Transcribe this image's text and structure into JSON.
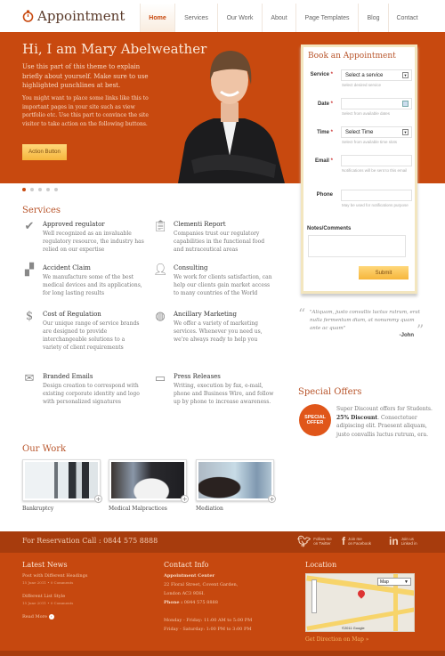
{
  "header": {
    "logo_text": "Appointment",
    "nav": [
      "Home",
      "Services",
      "Our Work",
      "About",
      "Page Templates",
      "Blog",
      "Contact"
    ],
    "active": "Home"
  },
  "hero": {
    "title": "Hi, I am Mary Abelweather",
    "p1": "Use this part of this theme to explain briefly about yourself. Make sure to use highlighted punchlines at best.",
    "p2": "You might want to place some links like this to important pages in your site such as view portfolio etc. Use this part to convince the site visitor to take action on the following buttons.",
    "button": "Action Button",
    "slides": 5,
    "active_slide": 1
  },
  "form": {
    "title": "Book an Appointment",
    "service_label": "Service",
    "service_value": "Select a service",
    "service_help": "Select desired service",
    "date_label": "Date",
    "date_value": "",
    "date_help": "Select from available dates",
    "time_label": "Time",
    "time_value": "Select Time",
    "time_help": "Select from available time slots",
    "email_label": "Email",
    "email_value": "",
    "email_help": "Notifications will be sent to this email",
    "phone_label": "Phone",
    "phone_value": "",
    "phone_help": "May be used for notifications purpose",
    "notes_label": "Notes/Comments",
    "notes_value": "",
    "submit": "Submit",
    "required": "*"
  },
  "services": {
    "title": "Services",
    "items": [
      {
        "icon": "check-icon",
        "title": "Approved regulator",
        "desc": "Well recognized as an invaluable regulatory resource, the industry has relied on our expertise"
      },
      {
        "icon": "clipboard-icon",
        "title": "Clementi Report",
        "desc": "Companies trust our regulatory capabilities in the functional food and nutraceutical areas"
      },
      {
        "icon": "documents-icon",
        "title": "Accident Claim",
        "desc": "We manufacture some of the best medical devices and its applications, for long lasting results"
      },
      {
        "icon": "user-icon",
        "title": "Consulting",
        "desc": "We work for clients satisfaction, can help our clients gain market access to many countries of the World"
      },
      {
        "icon": "dollar-icon",
        "title": "Cost of Regulation",
        "desc": "Our unique range of service brands are designed to provide interchangeable solutions to a variety of client requirements"
      },
      {
        "icon": "globe-icon",
        "title": "Ancillary Marketing",
        "desc": "We offer a variety of marketing services. Whenever you need us, we're always ready to help you"
      },
      {
        "icon": "envelope-icon",
        "title": "Branded Emails",
        "desc": "Design creation to correspond with existing corporate identity and logo with personalized signatures"
      },
      {
        "icon": "monitor-icon",
        "title": "Press Releases",
        "desc": "Writing, execution by fax, e-mail, phone and Business Wire, and follow up by phone to increase awareness."
      }
    ]
  },
  "quote": {
    "text": "\"Aliquam, justo convallis luctus rutrum, erat nulla fermentum diam, at nonummy quam ante ac quam\"",
    "author": "-John"
  },
  "offers": {
    "title": "Special Offers",
    "badge": "SPECIAL OFFER",
    "text_before": "Super Discount offers for Students. ",
    "highlight": "25% Discount",
    "text_after": ". Consectetuer adipiscing elit. Praesent aliquam, justo convallis luctus rutrum, era."
  },
  "work": {
    "title": "Our Work",
    "items": [
      "Bankruptcy",
      "Medical Malpractices",
      "Mediation"
    ]
  },
  "footer": {
    "reservation": "For Reservation Call : 0844 575 8888",
    "social": [
      {
        "icon": "twitter-icon",
        "l1": "Follow me",
        "l2": "on Twitter"
      },
      {
        "icon": "facebook-icon",
        "l1": "Join me",
        "l2": "on Facebook"
      },
      {
        "icon": "linkedin-icon",
        "l1": "Join us",
        "l2": "Linked in"
      }
    ],
    "news": {
      "title": "Latest News",
      "posts": [
        {
          "title": "Post with Different Headings",
          "meta": "15 June 2011 • 0 Comments"
        },
        {
          "title": "Different List Style",
          "meta": "15 June 2011 • 0 Comments"
        }
      ],
      "read_more": "Read More"
    },
    "contact": {
      "title": "Contact Info",
      "name": "Appointment Center",
      "addr1": "22 Floral Street, Covent Garden,",
      "addr2": "London AC3 9DH.",
      "phone_label": "Phone :",
      "phone": "0844 575 8888",
      "hours1": "Monday - Friday: 11:00 AM to 5:00 PM",
      "hours2": "Friday - Saturday: 1:00 PM to 3:00 PM"
    },
    "location": {
      "title": "Location",
      "map_type": "Map",
      "map_credit": "©2011 Google",
      "direction": "Get Direction on Map »"
    }
  },
  "colors": {
    "primary": "#c8490f",
    "dark": "#a73c0d",
    "heading": "#b8542a",
    "button": "#f6b63c"
  }
}
